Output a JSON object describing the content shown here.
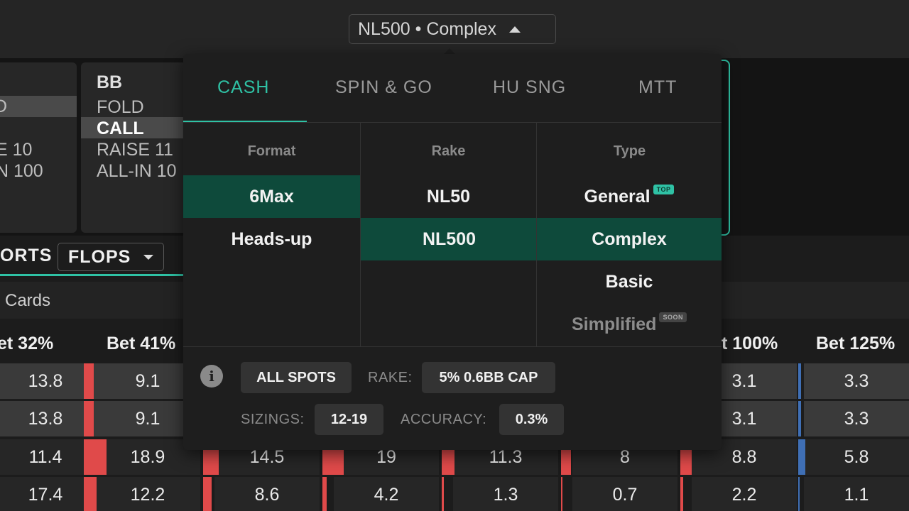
{
  "header": {
    "selector_label": "NL500 • Complex"
  },
  "background": {
    "left_card": {
      "lines": [
        "D",
        "E 10",
        "N 100"
      ]
    },
    "bb_card": {
      "title": "BB",
      "actions": [
        "FOLD",
        "CALL",
        "RAISE 11",
        "ALL-IN 10"
      ]
    },
    "ports_label": "ORTS",
    "flops_button": "FLOPS",
    "cards_label": "Cards",
    "table": {
      "headers": [
        "et 32%",
        "Bet 41%",
        "t 100%",
        "Bet 125%"
      ],
      "rows": [
        [
          "13.8",
          "9.1",
          "",
          "",
          "",
          "",
          "3.1",
          "3.3"
        ],
        [
          "13.8",
          "9.1",
          "",
          "",
          "",
          "",
          "3.1",
          "3.3"
        ],
        [
          "11.4",
          "18.9",
          "14.5",
          "19",
          "11.3",
          "8",
          "8.8",
          "5.8"
        ],
        [
          "17.4",
          "12.2",
          "8.6",
          "4.2",
          "1.3",
          "0.7",
          "2.2",
          "1.1"
        ]
      ]
    }
  },
  "dropdown": {
    "tabs": [
      "CASH",
      "SPIN & GO",
      "HU SNG",
      "MTT"
    ],
    "active_tab": "CASH",
    "columns": {
      "format": {
        "header": "Format",
        "options": [
          "6Max",
          "Heads-up"
        ],
        "selected": "6Max"
      },
      "rake": {
        "header": "Rake",
        "options": [
          "NL50",
          "NL500"
        ],
        "selected": "NL500"
      },
      "type": {
        "header": "Type",
        "options": [
          "General",
          "Complex",
          "Basic",
          "Simplified"
        ],
        "selected": "Complex",
        "badges": {
          "general": "TOP",
          "simplified": "SOON"
        }
      }
    },
    "footer": {
      "all_spots": "ALL SPOTS",
      "rake_label": "RAKE:",
      "rake_value": "5% 0.6BB CAP",
      "sizings_label": "SIZINGS:",
      "sizings_value": "12-19",
      "accuracy_label": "ACCURACY:",
      "accuracy_value": "0.3%"
    }
  },
  "colors": {
    "accent": "#2fc2a5",
    "selected_bg": "#0e4a3b",
    "bar_red": "#e04a4a",
    "bar_blue": "#3f6fb5"
  }
}
